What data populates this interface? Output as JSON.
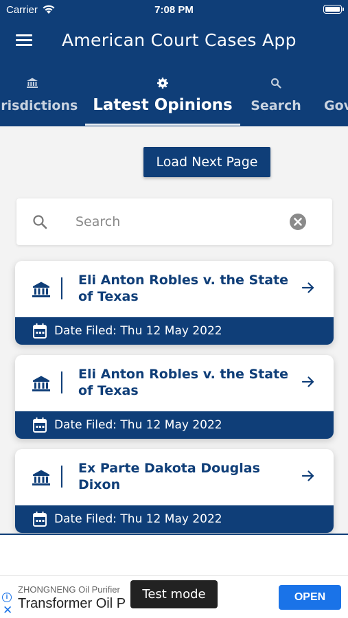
{
  "status_bar": {
    "carrier": "Carrier",
    "time": "7:08 PM"
  },
  "header": {
    "title": "American Court Cases App"
  },
  "tabs": [
    {
      "label": "Jurisdictions",
      "icon": "bank-icon"
    },
    {
      "label": "Latest Opinions",
      "icon": "gear-icon",
      "active": true
    },
    {
      "label": "Search",
      "icon": "search-icon"
    },
    {
      "label": "Gov",
      "icon": ""
    }
  ],
  "load_next_label": "Load Next Page",
  "search": {
    "placeholder": "Search",
    "value": ""
  },
  "cases": [
    {
      "title": "Eli Anton Robles v. the State of Texas",
      "date": "Date Filed: Thu 12 May 2022"
    },
    {
      "title": "Eli Anton Robles v. the State of Texas",
      "date": "Date Filed: Thu 12 May 2022"
    },
    {
      "title": "Ex Parte Dakota Douglas Dixon",
      "date": "Date Filed: Thu 12 May 2022"
    }
  ],
  "ad": {
    "brand": "ZHONGNENG Oil Purifier",
    "headline": "Transformer Oil P",
    "test_mode": "Test mode",
    "open_label": "OPEN"
  },
  "colors": {
    "primary": "#0f3e78",
    "ad_blue": "#1a73e8"
  }
}
